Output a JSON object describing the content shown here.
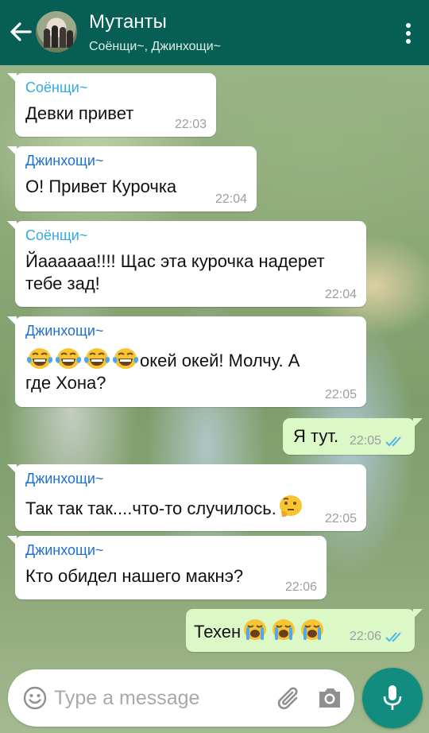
{
  "header": {
    "title": "Мутанты",
    "subtitle": "Соёнщи~, Джинхощи~"
  },
  "colors": {
    "header": "#075e54",
    "incoming_bubble": "#ffffff",
    "outgoing_bubble": "#dcf8c6",
    "sender_soenschi": "#35a9e6",
    "sender_jinhoschi": "#1f6fd1",
    "read_ticks": "#4fb6ec",
    "mic_button": "#128c7e"
  },
  "messages": [
    {
      "direction": "in",
      "sender": "Соёнщи~",
      "text": "Девки привет",
      "time": "22:03"
    },
    {
      "direction": "in",
      "sender": "Джинхощи~",
      "text": "О! Привет Курочка",
      "time": "22:04"
    },
    {
      "direction": "in",
      "sender": "Соёнщи~",
      "text_line1": "Йаааааа!!!! Щас эта курочка надерет",
      "text_line2": "тебе зад!",
      "time": "22:04"
    },
    {
      "direction": "in",
      "sender": "Джинхощи~",
      "emojis": [
        "face-with-tears-of-joy",
        "face-with-tears-of-joy",
        "face-with-tears-of-joy",
        "face-with-tears-of-joy"
      ],
      "text_line1": "окей окей! Молчу. А",
      "text_line2": "где Хона?",
      "time": "22:05"
    },
    {
      "direction": "out",
      "text": "Я тут.",
      "time": "22:05",
      "status": "read"
    },
    {
      "direction": "in",
      "sender": "Джинхощи~",
      "text": "Так так так....что-то случилось.",
      "emoji": "thinking-face",
      "time": "22:05"
    },
    {
      "direction": "in",
      "sender": "Джинхощи~",
      "text": "Кто обидел нашего макнэ?",
      "time": "22:06"
    },
    {
      "direction": "out",
      "text": "Техен",
      "emojis": [
        "loudly-crying-face",
        "loudly-crying-face",
        "loudly-crying-face"
      ],
      "time": "22:06",
      "status": "read"
    }
  ],
  "composer": {
    "placeholder": "Type a message"
  },
  "icons": {
    "back": "arrow-left-icon",
    "menu": "more-vert-icon",
    "emoji": "smiley-icon",
    "attach": "paperclip-icon",
    "camera": "camera-icon",
    "mic": "microphone-icon"
  }
}
